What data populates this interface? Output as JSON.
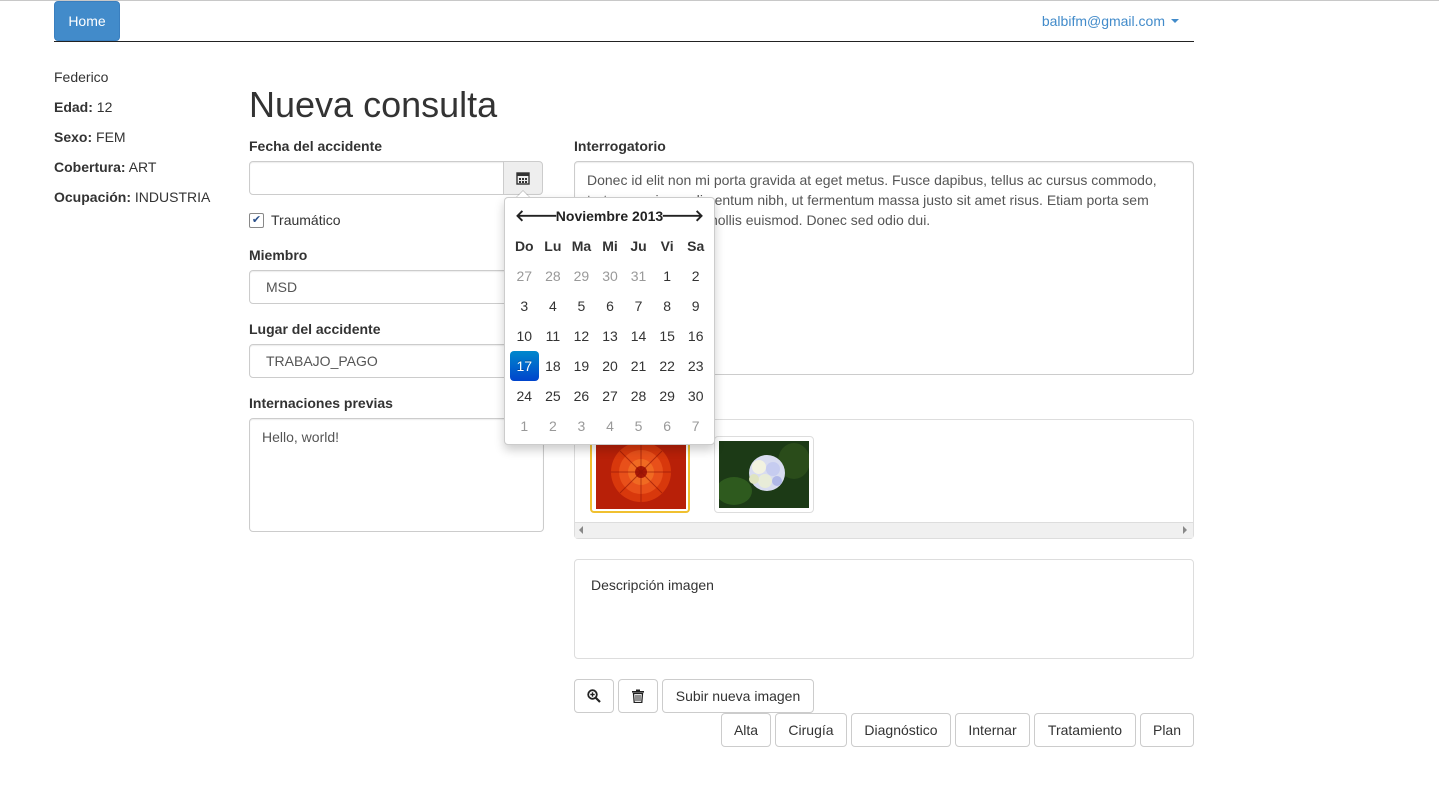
{
  "navbar": {
    "home_label": "Home",
    "user_email": "balbifm@gmail.com"
  },
  "patient": {
    "name": "Federico",
    "age_label": "Edad:",
    "age_value": "12",
    "sex_label": "Sexo:",
    "sex_value": "FEM",
    "coverage_label": "Cobertura:",
    "coverage_value": "ART",
    "occupation_label": "Ocupación:",
    "occupation_value": "INDUSTRIA"
  },
  "page_title": "Nueva consulta",
  "form": {
    "accident_date_label": "Fecha del accidente",
    "accident_date_value": "",
    "traumatic_label": "Traumático",
    "traumatic_checked": true,
    "member_label": "Miembro",
    "member_value": "MSD",
    "accident_place_label": "Lugar del accidente",
    "accident_place_value": "TRABAJO_PAGO",
    "prev_internments_label": "Internaciones previas",
    "prev_internments_value": "Hello, world!",
    "interrogation_label": "Interrogatorio",
    "interrogation_value": "Donec id elit non mi porta gravida at eget metus. Fusce dapibus, tellus ac cursus commodo, tortor mauris condimentum nibh, ut fermentum massa justo sit amet risus. Etiam porta sem malesuada magna mollis euismod. Donec sed odio dui.",
    "image_description_placeholder": "Descripción imagen"
  },
  "datepicker": {
    "month_label": "Noviembre 2013",
    "weekdays": [
      "Do",
      "Lu",
      "Ma",
      "Mi",
      "Ju",
      "Vi",
      "Sa"
    ],
    "weeks": [
      [
        "27",
        "28",
        "29",
        "30",
        "31",
        "1",
        "2"
      ],
      [
        "3",
        "4",
        "5",
        "6",
        "7",
        "8",
        "9"
      ],
      [
        "10",
        "11",
        "12",
        "13",
        "14",
        "15",
        "16"
      ],
      [
        "17",
        "18",
        "19",
        "20",
        "21",
        "22",
        "23"
      ],
      [
        "24",
        "25",
        "26",
        "27",
        "28",
        "29",
        "30"
      ],
      [
        "1",
        "2",
        "3",
        "4",
        "5",
        "6",
        "7"
      ]
    ],
    "selected_day": "17"
  },
  "images": [
    {
      "name": "red-flower-image",
      "selected": true
    },
    {
      "name": "hydrangea-image",
      "selected": false
    }
  ],
  "image_actions": {
    "zoom_icon": "zoom-in-icon",
    "delete_icon": "trash-icon",
    "upload_label": "Subir nueva imagen"
  },
  "action_buttons": [
    "Alta",
    "Cirugía",
    "Diagnóstico",
    "Internar",
    "Tratamiento",
    "Plan"
  ],
  "colors": {
    "primary": "#428bca",
    "datepicker_active": "#0066cc",
    "thumb_selected_border": "#f0c030"
  }
}
